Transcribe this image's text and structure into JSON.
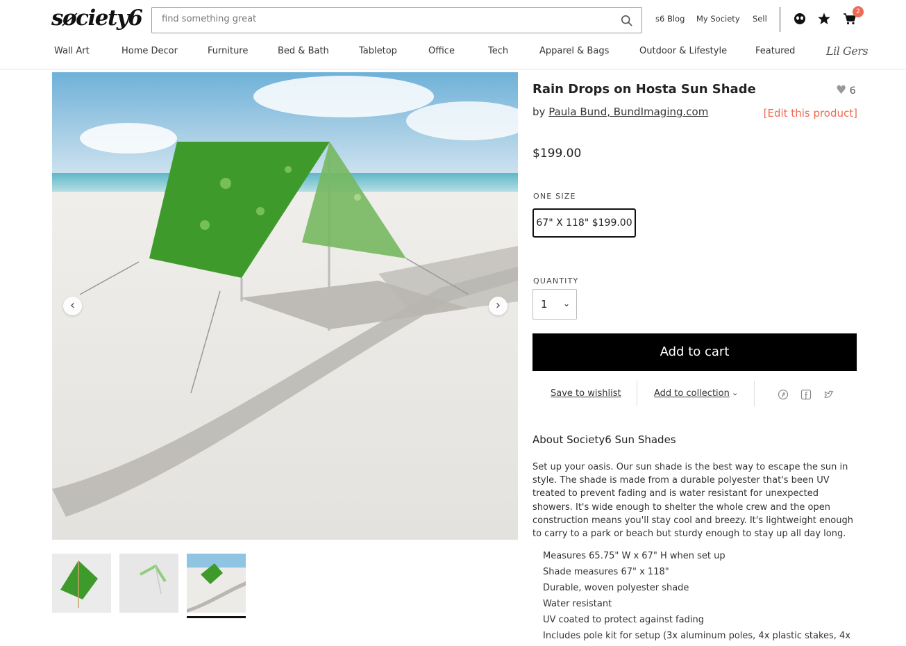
{
  "header": {
    "logo": "søciety6",
    "search_placeholder": "find something great",
    "links": [
      "s6 Blog",
      "My Society",
      "Sell"
    ],
    "cart_count": "2"
  },
  "nav": [
    "Wall Art",
    "Home Decor",
    "Furniture",
    "Bed & Bath",
    "Tabletop",
    "Office",
    "Tech",
    "Apparel & Bags",
    "Outdoor & Lifestyle",
    "Featured",
    "Lil Gers"
  ],
  "product": {
    "title": "Rain Drops on Hosta Sun Shade",
    "likes": "6",
    "by_prefix": "by",
    "artist": "Paula Bund, BundImaging.com",
    "edit_link": "[Edit this product]",
    "price": "$199.00",
    "size_label": "ONE SIZE",
    "size_option": "67\" X 118\" $199.00",
    "quantity_label": "QUANTITY",
    "quantity_value": "1",
    "add_to_cart": "Add to cart",
    "save_wishlist": "Save to wishlist",
    "add_collection": "Add to collection"
  },
  "about": {
    "heading": "About Society6 Sun Shades",
    "description": "Set up your oasis. Our sun shade is the best way to escape the sun in style. The shade is made from a durable polyester that's been UV treated to prevent fading and is water resistant for unexpected showers. It's wide enough to shelter the whole crew and the open construction means you'll stay cool and breezy. It's lightweight enough to carry to a park or beach but sturdy enough to stay up all day long.",
    "bullets": [
      "Measures 65.75\" W x 67\" H when set up",
      "Shade measures 67\" x 118\"",
      "Durable, woven polyester shade",
      "Water resistant",
      "UV coated to protect against fading",
      "Includes pole kit for setup (3x aluminum poles, 4x plastic stakes, 4x"
    ]
  },
  "colors": {
    "accent": "#ef6a52",
    "button": "#000000",
    "shade_green": "#3f9a2c"
  }
}
